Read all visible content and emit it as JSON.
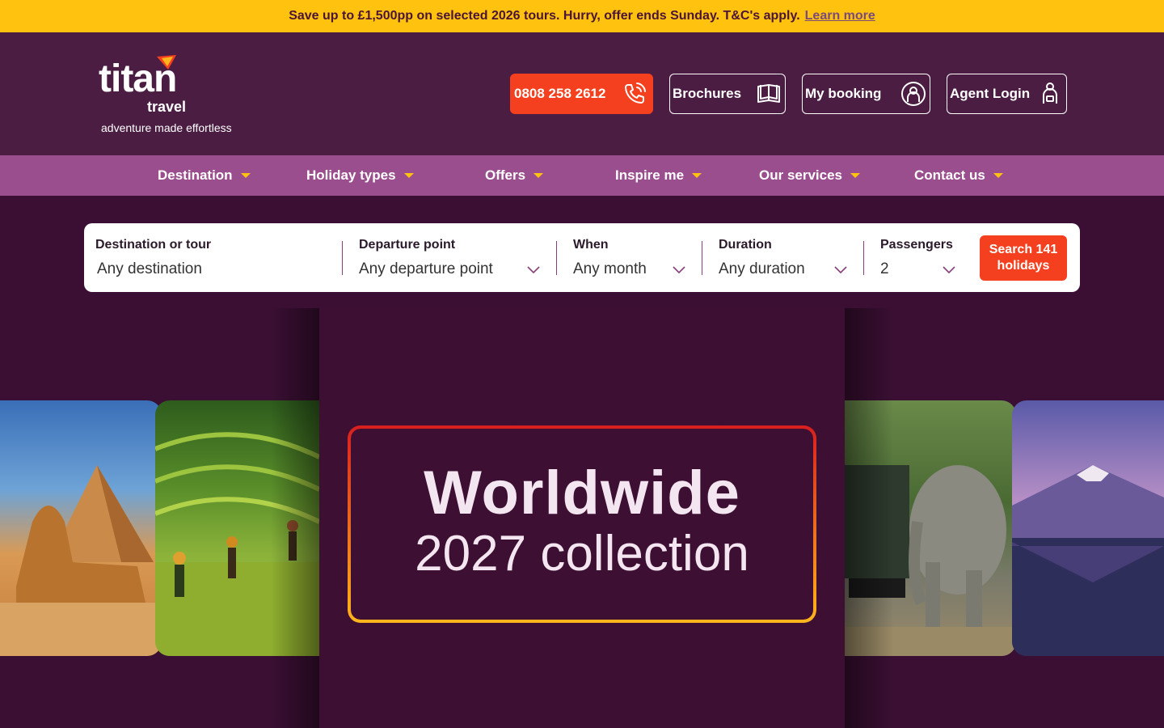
{
  "promo": {
    "text": "Save up to £1,500pp on selected 2026 tours. Hurry, offer ends Sunday. T&C's apply.",
    "link": "Learn more"
  },
  "logo": {
    "word": "titan",
    "sub": "travel",
    "tagline": "adventure made effortless"
  },
  "header": {
    "phone": "0808 258 2612",
    "brochures": "Brochures",
    "booking": "My booking",
    "agent": "Agent Login"
  },
  "nav": [
    "Destination",
    "Holiday types",
    "Offers",
    "Inspire me",
    "Our services",
    "Contact us"
  ],
  "search": {
    "fields": [
      {
        "label": "Destination or tour",
        "value": "Any destination"
      },
      {
        "label": "Departure point",
        "value": "Any departure point"
      },
      {
        "label": "When",
        "value": "Any month"
      },
      {
        "label": "Duration",
        "value": "Any duration"
      },
      {
        "label": "Passengers",
        "value": "2"
      }
    ],
    "button": "Search 141 holidays"
  },
  "hero": {
    "title": "Worldwide",
    "subtitle": "2027 collection"
  },
  "colors": {
    "promo": "#ffc20e",
    "header": "#4b1d43",
    "nav": "#9b4e8e",
    "accent": "#f5401f",
    "hero": "#3a0f33"
  }
}
